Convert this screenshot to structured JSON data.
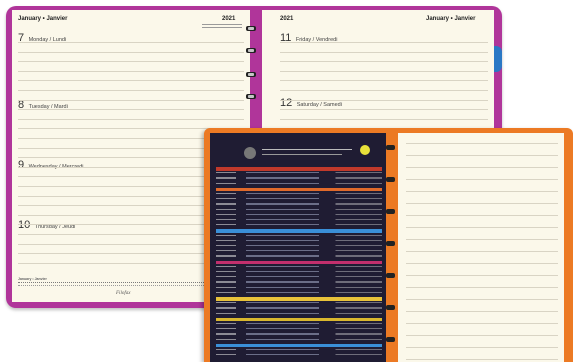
{
  "left_page": {
    "header_left": "January • Janvier",
    "header_right": "2021",
    "days": [
      {
        "num": "7",
        "name": "Monday / Lundi"
      },
      {
        "num": "8",
        "name": "Tuesday / Mardi"
      },
      {
        "num": "9",
        "name": "Wednesday / Mercredi"
      },
      {
        "num": "10",
        "name": "Thursday / Jeudi"
      }
    ],
    "footer_month": "January • Janvier",
    "brand": "Filofax"
  },
  "right_page": {
    "header_left": "2021",
    "header_right": "January • Janvier",
    "days": [
      {
        "num": "11",
        "name": "Friday / Vendredi"
      },
      {
        "num": "12",
        "name": "Saturday / Samedi"
      }
    ]
  },
  "colors": {
    "magenta_cover": "#b0359a",
    "orange_cover": "#ec7a24",
    "paper": "#fbf8ea",
    "blue_tab": "#2a78c5"
  }
}
